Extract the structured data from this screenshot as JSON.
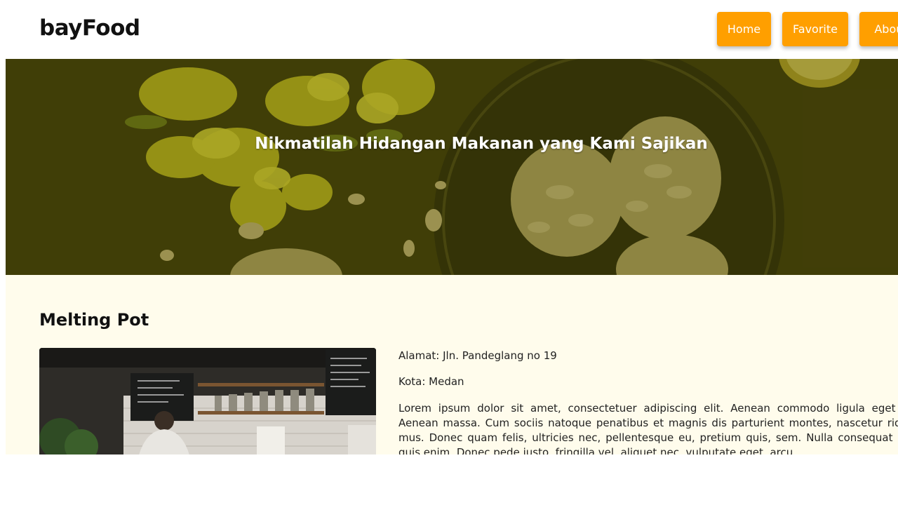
{
  "header": {
    "logo": "bayFood",
    "nav": [
      {
        "label": "Home"
      },
      {
        "label": "Favorite"
      },
      {
        "label": "About"
      }
    ],
    "nav_color": "#ff9f00"
  },
  "hero": {
    "title": "Nikmatilah Hidangan Makanan yang Kami Sajikan"
  },
  "restaurant": {
    "name": "Melting Pot",
    "address": "Alamat: Jln. Pandeglang no 19",
    "city": "Kota: Medan",
    "description": "Lorem ipsum dolor sit amet, consectetuer adipiscing elit. Aenean commodo ligula eget dolor. Aenean massa. Cum sociis natoque penatibus et magnis dis parturient montes, nascetur ridiculus mus. Donec quam felis, ultricies nec, pellentesque eu, pretium quis, sem. Nulla consequat massa quis enim. Donec pede justo, fringilla vel, aliquet nec, vulputate eget, arcu."
  },
  "colors": {
    "content_bg": "#fffcec",
    "hero_tint": "#4a4700"
  }
}
